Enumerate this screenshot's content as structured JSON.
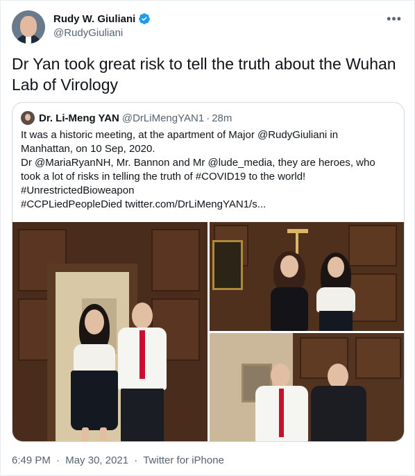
{
  "author": {
    "display_name": "Rudy W. Giuliani",
    "handle": "@RudyGiuliani",
    "verified": true
  },
  "tweet": {
    "text": "Dr Yan took great risk to tell the truth about the Wuhan Lab of Virology"
  },
  "quoted": {
    "display_name": "Dr. Li-Meng YAN",
    "handle": "@DrLiMengYAN1",
    "separator": "·",
    "time": "28m",
    "lines": [
      "It was a historic meeting, at the apartment of Major @RudyGiuliani in",
      "Manhattan, on 10 Sep, 2020.",
      "Dr @MariaRyanNH, Mr. Bannon and Mr @lude_media, they are heroes, who",
      "took a lot of risks in telling the truth of #COVID19 to the world!",
      "#UnrestrictedBioweapon",
      "#CCPLiedPeopleDied  twitter.com/DrLiMengYAN1/s..."
    ]
  },
  "footer": {
    "time": "6:49 PM",
    "sep1": "·",
    "date": "May 30, 2021",
    "sep2": "·",
    "source": "Twitter for iPhone"
  },
  "colors": {
    "text": "#0f1419",
    "secondary": "#536471",
    "verified": "#1d9bf0",
    "border": "#cfd9de"
  },
  "icons": {
    "more": "more-horizontal-icon",
    "verified": "verified-badge-icon"
  }
}
